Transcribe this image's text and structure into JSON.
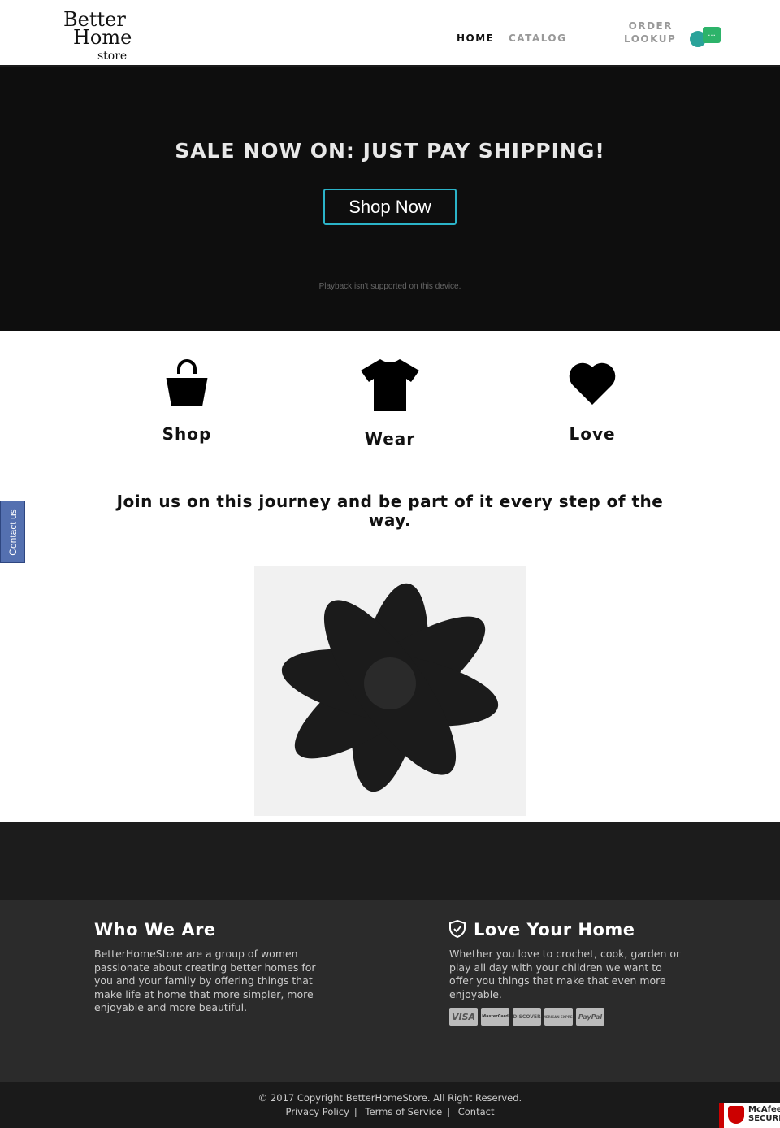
{
  "header": {
    "logo": [
      "Better",
      "Home",
      "store"
    ],
    "nav": [
      "HOME",
      "CATALOG",
      "ORDER LOOKUP"
    ],
    "chat_icon": "..."
  },
  "hero": {
    "title": "SALE NOW ON: JUST PAY SHIPPING!",
    "button": "Shop Now",
    "playback": "Playback isn't supported on this device."
  },
  "features": [
    {
      "label": "Shop",
      "icon": "shopping-bag-icon"
    },
    {
      "label": "Wear",
      "icon": "tshirt-icon"
    },
    {
      "label": "Love",
      "icon": "heart-icon"
    }
  ],
  "tagline": "Join us on this journey and be part of it every step of the way.",
  "contact_tab": "Contact us",
  "footer": {
    "who": {
      "title": "Who We Are",
      "text": "BetterHomeStore are a group of women passionate about creating better homes for you and your family by offering things that make life at home that more simpler, more enjoyable and more beautiful."
    },
    "love": {
      "title": "Love Your Home",
      "text": "Whether you love to crochet, cook, garden or play all day with your children we want to offer you things that make that even more enjoyable."
    },
    "cards": [
      "VISA",
      "MasterCard",
      "DISCOVER",
      "AMERICAN EXPRESS",
      "PayPal"
    ],
    "copyright": "© 2017 Copyright BetterHomeStore. All Right Reserved.",
    "links": [
      "Privacy Policy",
      "Terms of Service",
      "Contact"
    ],
    "badge": [
      "McAfee",
      "SECURE"
    ]
  }
}
